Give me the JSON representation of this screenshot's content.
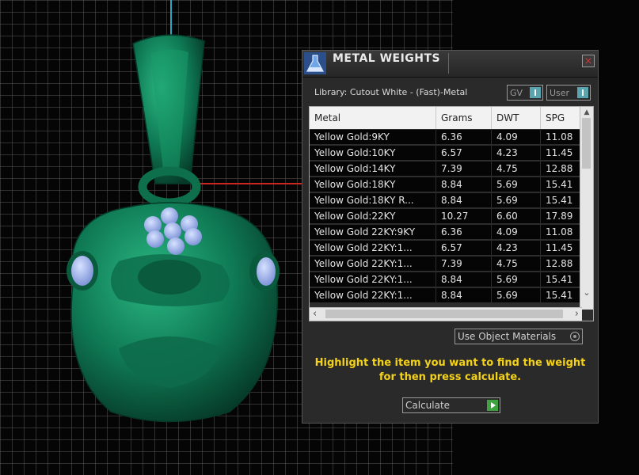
{
  "colors": {
    "accent_teal": "#5aa4b0",
    "instruction_yellow": "#f4d21a",
    "model_green": "#0f7a55",
    "gem_blue": "#9fb4e8",
    "calc_green": "#3ea23e"
  },
  "dialog": {
    "title": "METAL WEIGHTS",
    "close_label": "×",
    "library_label": "Library: Cutout White - (Fast)-Metal",
    "gv_select": "GV",
    "user_select": "User",
    "columns": [
      "Metal",
      "Grams",
      "DWT",
      "SPG"
    ],
    "rows": [
      [
        "Yellow Gold:9KY",
        "6.36",
        "4.09",
        "11.08"
      ],
      [
        "Yellow Gold:10KY",
        "6.57",
        "4.23",
        "11.45"
      ],
      [
        "Yellow Gold:14KY",
        "7.39",
        "4.75",
        "12.88"
      ],
      [
        "Yellow Gold:18KY",
        "8.84",
        "5.69",
        "15.41"
      ],
      [
        "Yellow Gold:18KY R...",
        "8.84",
        "5.69",
        "15.41"
      ],
      [
        "Yellow Gold:22KY",
        "10.27",
        "6.60",
        "17.89"
      ],
      [
        "Yellow Gold 22KY:9KY",
        "6.36",
        "4.09",
        "11.08"
      ],
      [
        "Yellow Gold 22KY:1...",
        "6.57",
        "4.23",
        "11.45"
      ],
      [
        "Yellow Gold 22KY:1...",
        "7.39",
        "4.75",
        "12.88"
      ],
      [
        "Yellow Gold 22KY:1...",
        "8.84",
        "5.69",
        "15.41"
      ],
      [
        "Yellow Gold 22KY:1...",
        "8.84",
        "5.69",
        "15.41"
      ]
    ],
    "use_object_materials": "Use Object Materials",
    "instruction_line1": "Highlight the item you want to find the weight",
    "instruction_line2": "for then press calculate.",
    "calculate_label": "Calculate"
  }
}
